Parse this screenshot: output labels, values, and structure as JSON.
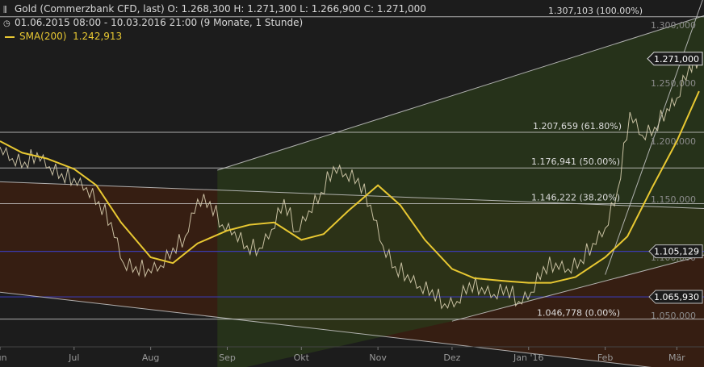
{
  "header": {
    "title_line": "Gold (Commerzbank CFD, last)  O: 1.268,300  H: 1.271,300  L: 1.266,900  C: 1.271,000",
    "range_line": "01.06.2015 08:00 - 10.03.2016 21:00 (9 Monate, 1 Stunde)",
    "sma_label": "SMA(200)",
    "sma_value": "1.242,913",
    "bars_icon": "bars-icon",
    "clock_icon": "clock-icon"
  },
  "colors": {
    "background": "#1c1c1c",
    "sma": "#e8c832",
    "price": "#d9cfb0",
    "fib_line": "#d0d0d0",
    "blue_line": "#3a3ab0",
    "channel_down_fill": "#3a1f12",
    "channel_up_fill": "#2a3a1a"
  },
  "chart_data": {
    "type": "line",
    "title": "Gold (Commerzbank CFD, last)",
    "ylim": [
      1040,
      1315
    ],
    "y_ticks": [
      "1.050,000",
      "1.100,000",
      "1.150,000",
      "1.200,000",
      "1.250,000",
      "1.300,000"
    ],
    "y_tick_values": [
      1050,
      1100,
      1150,
      1200,
      1250,
      1300
    ],
    "x_ticks": [
      "Jun",
      "Jul",
      "Aug",
      "Sep",
      "Okt",
      "Nov",
      "Dez",
      "Jan '16",
      "Feb",
      "Mär"
    ],
    "x_tick_dates": [
      "2015-06-01",
      "2015-07-01",
      "2015-08-01",
      "2015-09-01",
      "2015-10-01",
      "2015-11-01",
      "2015-12-01",
      "2016-01-01",
      "2016-02-01",
      "2016-03-01"
    ],
    "x_range": [
      "2015-06-01",
      "2016-03-12"
    ],
    "series": [
      {
        "name": "Gold (Commerzbank CFD, last)",
        "x": [
          "2015-06-01",
          "2015-06-06",
          "2015-06-11",
          "2015-06-16",
          "2015-06-21",
          "2015-06-26",
          "2015-07-01",
          "2015-07-06",
          "2015-07-11",
          "2015-07-16",
          "2015-07-21",
          "2015-07-26",
          "2015-07-31",
          "2015-08-05",
          "2015-08-10",
          "2015-08-15",
          "2015-08-20",
          "2015-08-25",
          "2015-08-30",
          "2015-09-04",
          "2015-09-09",
          "2015-09-14",
          "2015-09-19",
          "2015-09-24",
          "2015-09-29",
          "2015-10-04",
          "2015-10-09",
          "2015-10-14",
          "2015-10-19",
          "2015-10-24",
          "2015-10-29",
          "2015-11-03",
          "2015-11-08",
          "2015-11-13",
          "2015-11-18",
          "2015-11-23",
          "2015-11-28",
          "2015-12-03",
          "2015-12-08",
          "2015-12-13",
          "2015-12-18",
          "2015-12-23",
          "2015-12-28",
          "2016-01-02",
          "2016-01-07",
          "2016-01-12",
          "2016-01-17",
          "2016-01-22",
          "2016-01-27",
          "2016-02-01",
          "2016-02-06",
          "2016-02-11",
          "2016-02-16",
          "2016-02-21",
          "2016-02-26",
          "2016-03-01",
          "2016-03-06",
          "2016-03-10"
        ],
        "values": [
          1195,
          1185,
          1182,
          1190,
          1178,
          1172,
          1168,
          1160,
          1148,
          1130,
          1095,
          1092,
          1090,
          1093,
          1108,
          1118,
          1150,
          1148,
          1128,
          1122,
          1110,
          1108,
          1124,
          1150,
          1122,
          1140,
          1156,
          1178,
          1172,
          1168,
          1145,
          1110,
          1092,
          1085,
          1075,
          1072,
          1060,
          1062,
          1078,
          1074,
          1068,
          1075,
          1062,
          1070,
          1092,
          1095,
          1090,
          1098,
          1112,
          1125,
          1158,
          1225,
          1205,
          1212,
          1228,
          1237,
          1265,
          1271
        ]
      },
      {
        "name": "SMA(200)",
        "x": [
          "2015-06-01",
          "2015-06-10",
          "2015-06-20",
          "2015-07-01",
          "2015-07-10",
          "2015-07-20",
          "2015-08-01",
          "2015-08-10",
          "2015-08-20",
          "2015-09-01",
          "2015-09-10",
          "2015-09-20",
          "2015-10-01",
          "2015-10-10",
          "2015-10-20",
          "2015-11-01",
          "2015-11-10",
          "2015-11-20",
          "2015-12-01",
          "2015-12-10",
          "2015-12-20",
          "2016-01-01",
          "2016-01-10",
          "2016-01-20",
          "2016-02-01",
          "2016-02-10",
          "2016-02-20",
          "2016-03-01",
          "2016-03-10"
        ],
        "values": [
          1200,
          1190,
          1185,
          1176,
          1162,
          1130,
          1100,
          1095,
          1112,
          1123,
          1128,
          1130,
          1115,
          1120,
          1140,
          1162,
          1145,
          1115,
          1090,
          1082,
          1080,
          1078,
          1078,
          1083,
          1100,
          1118,
          1160,
          1200,
          1243
        ]
      }
    ],
    "fibonacci_levels": [
      {
        "label": "1.307,103 (100.00%)",
        "value": 1307.103
      },
      {
        "label": "1.207,659 (61.80%)",
        "value": 1207.659
      },
      {
        "label": "1.176,941 (50.00%)",
        "value": 1176.941
      },
      {
        "label": "1.146,222 (38.20%)",
        "value": 1146.222
      },
      {
        "label": "1.046,778 (0.00%)",
        "value": 1046.778
      }
    ],
    "horizontal_levels": [
      {
        "label": "1.105,129",
        "value": 1105.129
      },
      {
        "label": "1.065,930",
        "value": 1065.93
      }
    ],
    "last_price_label": "1.271,000",
    "last_price": 1271.0,
    "channels": {
      "down_upper": [
        [
          "2015-06-01",
          1165
        ],
        [
          "2016-03-12",
          1142
        ]
      ],
      "down_lower": [
        [
          "2015-06-01",
          1070
        ],
        [
          "2016-03-12",
          1000
        ]
      ],
      "up_upper": [
        [
          "2015-08-28",
          1175
        ],
        [
          "2016-03-12",
          1308
        ]
      ],
      "up_lower": [
        [
          "2015-12-01",
          1045
        ],
        [
          "2016-03-12",
          1102
        ]
      ],
      "up_steep": [
        [
          "2016-02-01",
          1085
        ],
        [
          "2016-03-12",
          1325
        ]
      ]
    },
    "grid": false,
    "legend": "top-left"
  }
}
